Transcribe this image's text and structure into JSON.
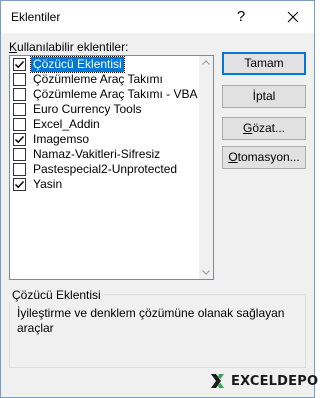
{
  "window": {
    "title": "Eklentiler",
    "help_glyph": "?",
    "close_icon": "close-icon"
  },
  "available": {
    "label_prefix": "K",
    "label_rest": "ullanılabilir eklentiler:",
    "items": [
      {
        "label": "Çözücü Eklentisi",
        "checked": true,
        "selected": true
      },
      {
        "label": "Çözümleme Araç Takımı",
        "checked": false,
        "selected": false
      },
      {
        "label": "Çözümleme Araç Takımı - VBA",
        "checked": false,
        "selected": false
      },
      {
        "label": "Euro Currency Tools",
        "checked": false,
        "selected": false
      },
      {
        "label": "Excel_Addin",
        "checked": false,
        "selected": false
      },
      {
        "label": "Imagemso",
        "checked": true,
        "selected": false
      },
      {
        "label": "Namaz-Vakitleri-Sifresiz",
        "checked": false,
        "selected": false
      },
      {
        "label": "Pastespecial2-Unprotected",
        "checked": false,
        "selected": false
      },
      {
        "label": "Yasin",
        "checked": true,
        "selected": false
      }
    ]
  },
  "buttons": {
    "ok": "Tamam",
    "cancel": "İptal",
    "browse_u": "G",
    "browse_rest": "özat...",
    "automation_u": "O",
    "automation_rest": "tomasyon..."
  },
  "details": {
    "title": "Çözücü Eklentisi",
    "description": "İyileştirme ve denklem çözümüne olanak sağlayan araçlar"
  },
  "watermark": {
    "text": "EXCELDEPO",
    "mark_icon": "x-logo-icon"
  },
  "colors": {
    "selection": "#0078d7",
    "default_button_border": "#0078d7",
    "dialog_bg": "#f0f0f0"
  }
}
